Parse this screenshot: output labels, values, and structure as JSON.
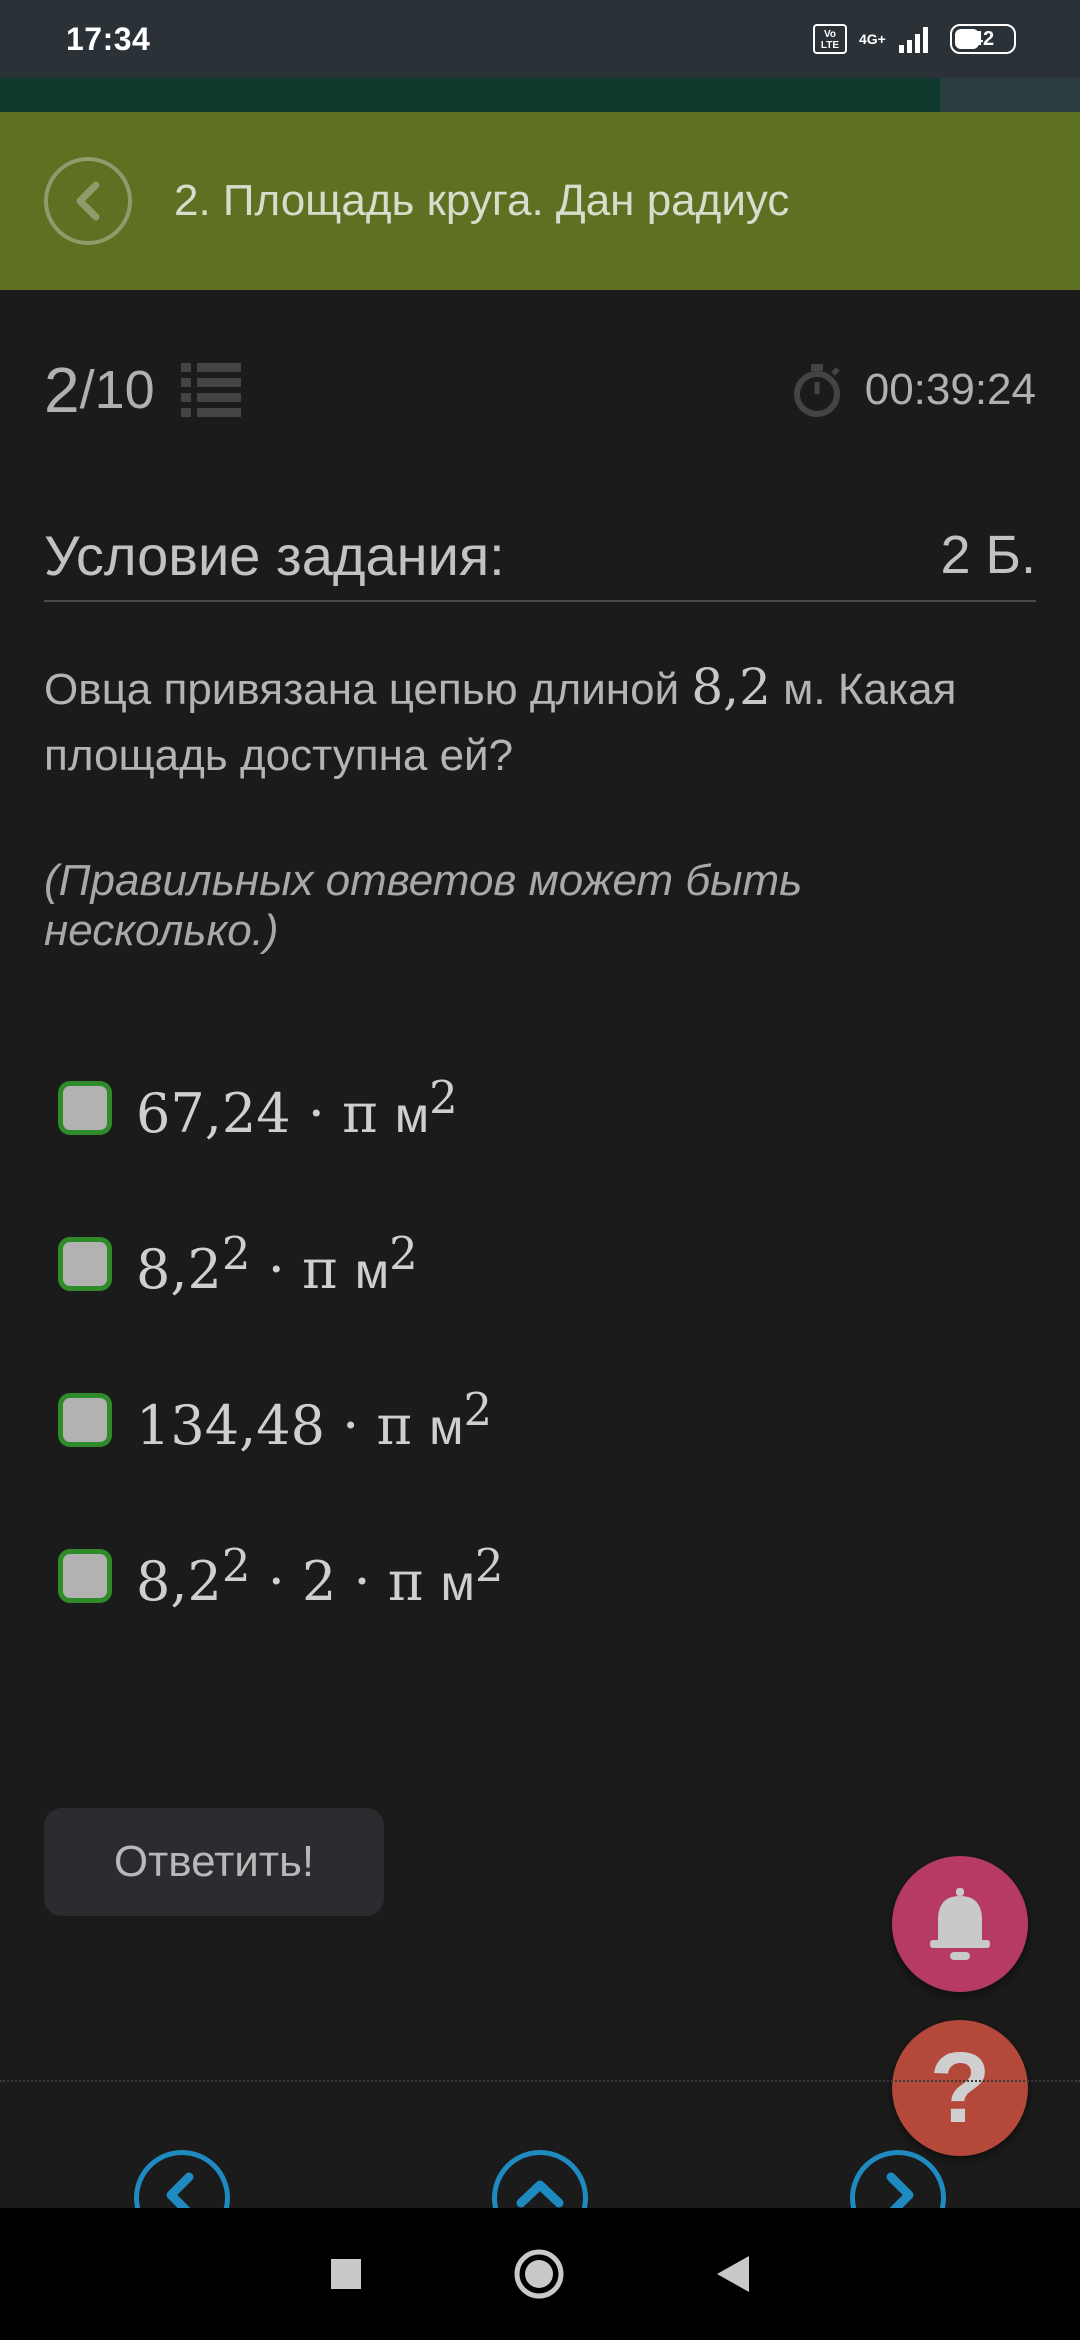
{
  "status_bar": {
    "time": "17:34",
    "volte_label": "Vo\nLTE",
    "network_label": "4G+",
    "battery_level": "42"
  },
  "header": {
    "title": "2. Площадь круга. Дан радиус"
  },
  "progress": {
    "current": "2",
    "total": "/10",
    "timer": "00:39:24"
  },
  "condition": {
    "title": "Условие задания:",
    "points": "2 Б."
  },
  "task": {
    "text_before": "Овца привязана цепью длиной ",
    "length": "8,2",
    "text_after": " м. Какая площадь доступна ей?",
    "hint": "(Правильных ответов может быть несколько.)"
  },
  "options": [
    {
      "formula": "67,24 · π ",
      "exp1": "",
      "unit": "м",
      "unit_exp": "2",
      "checked": false
    },
    {
      "formula": "8,2",
      "exp1": "2",
      "rest": " · π ",
      "unit": "м",
      "unit_exp": "2",
      "checked": false
    },
    {
      "formula": "134,48 · π ",
      "exp1": "",
      "unit": "м",
      "unit_exp": "2",
      "checked": false
    },
    {
      "formula": "8,2",
      "exp1": "2",
      "rest": " · 2 · π ",
      "unit": "м",
      "unit_exp": "2",
      "checked": false
    }
  ],
  "submit_label": "Ответить!",
  "help_label": "?",
  "colors": {
    "header_bg": "#5e7123",
    "checkbox_border": "#2f8a2a",
    "bell_fab": "#b63a62",
    "help_fab": "#b4483b",
    "nav_accent": "#1e8ac0"
  }
}
